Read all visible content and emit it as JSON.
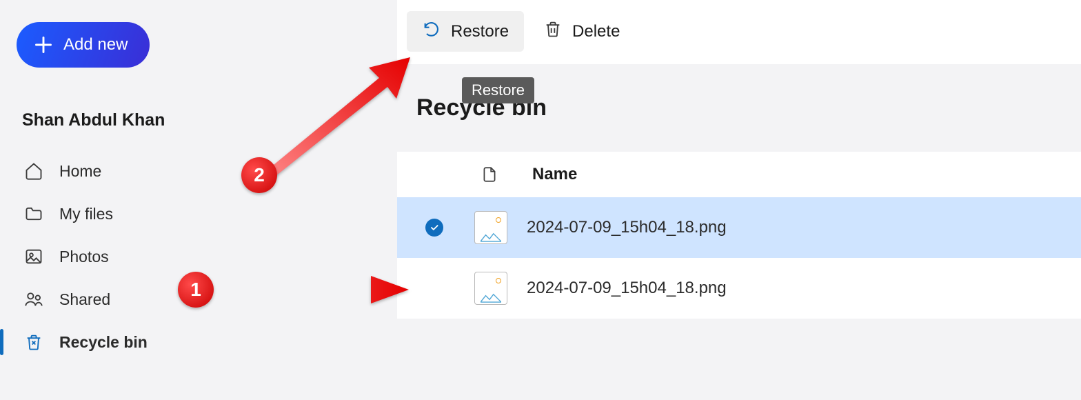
{
  "sidebar": {
    "add_new_label": "Add new",
    "user_name": "Shan Abdul Khan",
    "nav": [
      {
        "id": "home",
        "label": "Home"
      },
      {
        "id": "myfiles",
        "label": "My files"
      },
      {
        "id": "photos",
        "label": "Photos"
      },
      {
        "id": "shared",
        "label": "Shared"
      },
      {
        "id": "recyclebin",
        "label": "Recycle bin"
      }
    ]
  },
  "toolbar": {
    "restore_label": "Restore",
    "delete_label": "Delete"
  },
  "tooltip": {
    "text": "Restore"
  },
  "page": {
    "title": "Recycle bin"
  },
  "table": {
    "name_header": "Name",
    "rows": [
      {
        "filename": "2024-07-09_15h04_18.png",
        "selected": true
      },
      {
        "filename": "2024-07-09_15h04_18.png",
        "selected": false
      }
    ]
  },
  "annotations": {
    "step1": "1",
    "step2": "2"
  }
}
